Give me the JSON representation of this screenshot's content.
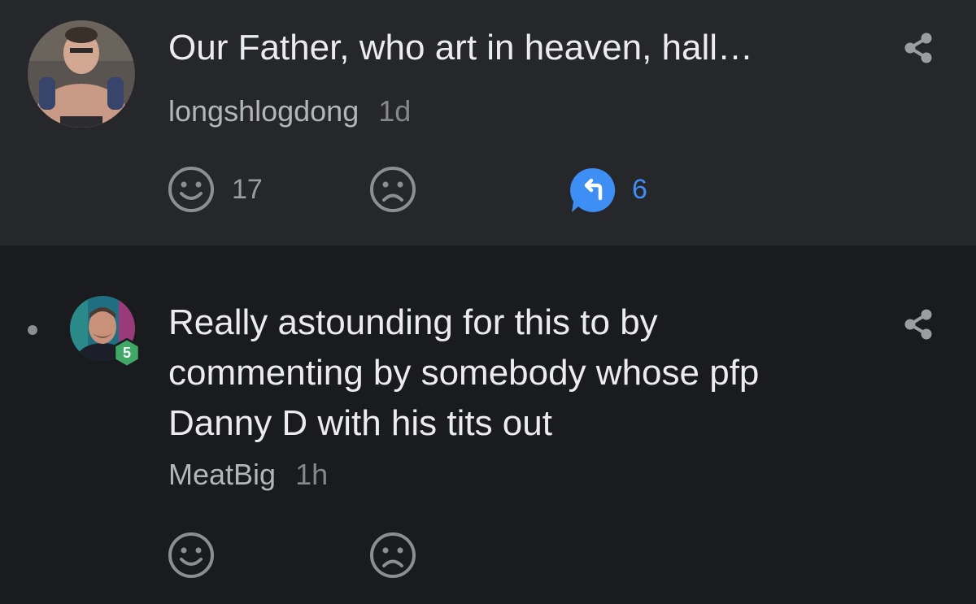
{
  "comments": [
    {
      "text": "Our Father, who art in heaven, hall…",
      "username": "longshlogdong",
      "timestamp": "1d",
      "likes": "17",
      "replies": "6",
      "avatar_icon": "shirtless-man-avatar",
      "actions": {
        "like_icon": "smiley-face-icon",
        "dislike_icon": "frowning-face-icon",
        "reply_icon": "reply-bubble-icon",
        "share_icon": "share-icon"
      }
    },
    {
      "text": "Really astounding for this to by\ncommenting by somebody whose pfp\nDanny D with his tits out",
      "username": "MeatBig",
      "timestamp": "1h",
      "level": "5",
      "avatar_icon": "man-portrait-avatar",
      "actions": {
        "like_icon": "smiley-face-icon",
        "dislike_icon": "frowning-face-icon",
        "share_icon": "share-icon"
      }
    }
  ],
  "colors": {
    "background": "#1a1b1e",
    "parent_background": "#26272b",
    "text": "#ececee",
    "muted": "#86878b",
    "accent_blue": "#3d8ef5",
    "level_badge": "#3fa866"
  }
}
